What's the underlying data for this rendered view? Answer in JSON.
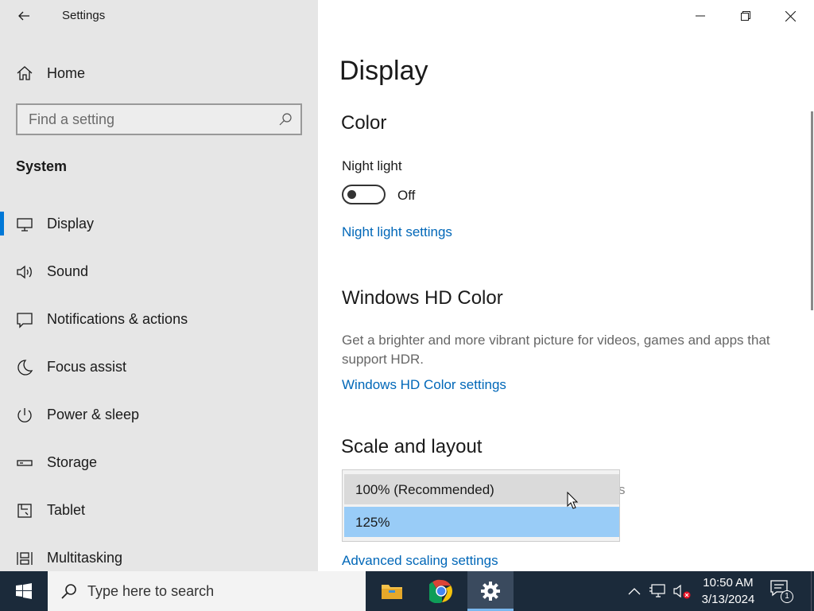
{
  "window": {
    "title": "Settings",
    "controls": {
      "minimize": "minimize-icon",
      "restore": "restore-icon",
      "close": "close-icon"
    }
  },
  "sidebar": {
    "home_label": "Home",
    "search_placeholder": "Find a setting",
    "section": "System",
    "items": [
      {
        "label": "Display",
        "icon": "monitor-icon",
        "selected": true
      },
      {
        "label": "Sound",
        "icon": "speaker-icon"
      },
      {
        "label": "Notifications & actions",
        "icon": "notification-icon"
      },
      {
        "label": "Focus assist",
        "icon": "moon-icon"
      },
      {
        "label": "Power & sleep",
        "icon": "power-icon"
      },
      {
        "label": "Storage",
        "icon": "storage-icon"
      },
      {
        "label": "Tablet",
        "icon": "tablet-icon"
      },
      {
        "label": "Multitasking",
        "icon": "multitasking-icon"
      }
    ]
  },
  "main": {
    "title": "Display",
    "color": {
      "heading": "Color",
      "night_light_label": "Night light",
      "night_light_state": "Off",
      "night_light_link": "Night light settings"
    },
    "hd_color": {
      "heading": "Windows HD Color",
      "description": "Get a brighter and more vibrant picture for videos, games and apps that support HDR.",
      "link": "Windows HD Color settings"
    },
    "scale": {
      "heading": "Scale and layout",
      "options": [
        "100% (Recommended)",
        "125%"
      ],
      "hovered_option": "100% (Recommended)",
      "selected_option": "125%",
      "partial_text": "s",
      "advanced_link": "Advanced scaling settings"
    }
  },
  "taskbar": {
    "search_placeholder": "Type here to search",
    "apps": [
      {
        "name": "File Explorer",
        "icon": "folder-icon"
      },
      {
        "name": "Google Chrome",
        "icon": "chrome-icon"
      },
      {
        "name": "Settings",
        "icon": "gear-icon",
        "active": true
      }
    ],
    "clock": {
      "time": "10:50 AM",
      "date": "3/13/2024"
    },
    "notification_count": "1"
  },
  "colors": {
    "accent": "#0078d7",
    "link": "#0067b8",
    "sidebar_bg": "#e6e6e6",
    "taskbar_bg": "#1b2a3a",
    "dropdown_selected": "#99ccf7"
  }
}
